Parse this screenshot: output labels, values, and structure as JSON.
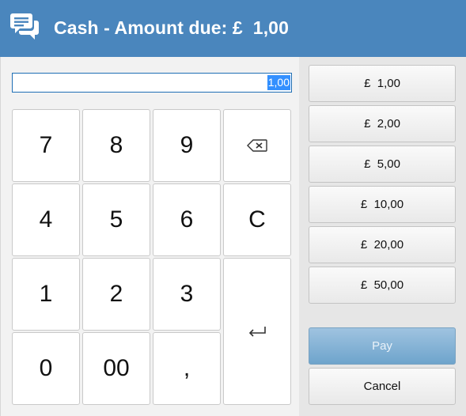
{
  "dialog": {
    "title": "Cash - Amount due: £  1,00",
    "icon": "chat-bubbles-icon"
  },
  "input": {
    "value": "1,00"
  },
  "keypad": {
    "k7": "7",
    "k8": "8",
    "k9": "9",
    "k4": "4",
    "k5": "5",
    "k6": "6",
    "k1": "1",
    "k2": "2",
    "k3": "3",
    "k0": "0",
    "k00": "00",
    "comma": ",",
    "clear": "C",
    "backspace_icon": "backspace-icon",
    "enter_icon": "enter-icon"
  },
  "quick_amounts": [
    "£  1,00",
    "£  2,00",
    "£  5,00",
    "£  10,00",
    "£  20,00",
    "£  50,00"
  ],
  "actions": {
    "pay": "Pay",
    "cancel": "Cancel"
  }
}
